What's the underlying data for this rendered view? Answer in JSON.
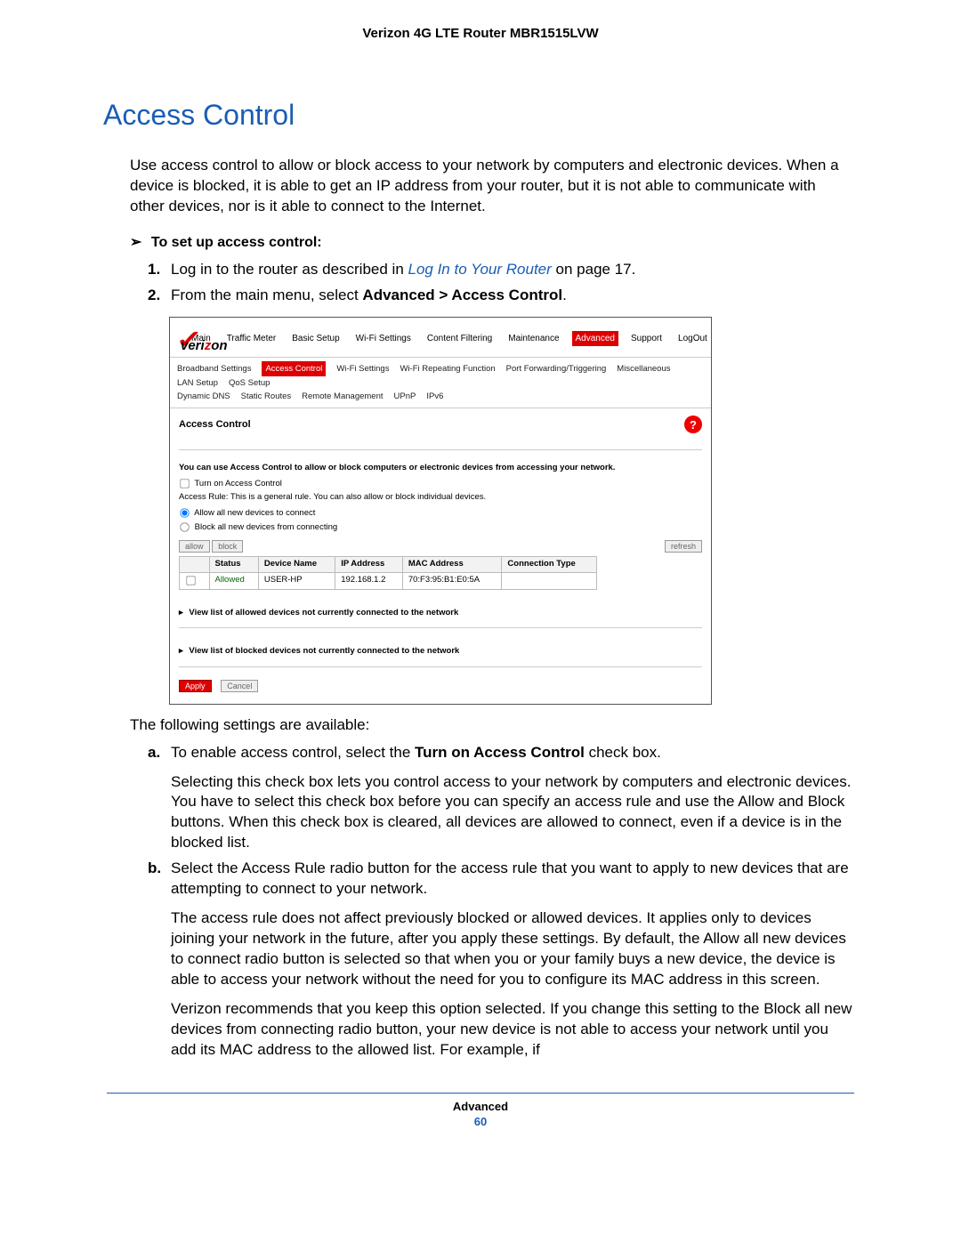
{
  "header": {
    "title": "Verizon 4G LTE Router MBR1515LVW"
  },
  "section": {
    "title": "Access Control"
  },
  "intro": "Use access control to allow or block access to your network by computers and electronic devices. When a device is blocked, it is able to get an IP address from your router, but it is not able to communicate with other devices, nor is it able to connect to the Internet.",
  "task_heading": "To set up access control:",
  "steps": {
    "s1_pre": "Log in to the router as described in ",
    "s1_link": "Log In to Your Router",
    "s1_post": " on page 17.",
    "s2_pre": "From the main menu, select ",
    "s2_bold": "Advanced > Access Control",
    "s2_post": "."
  },
  "router": {
    "logo_text_pre": "veri",
    "logo_text_hl": "z",
    "logo_text_post": "on",
    "mainnav": [
      "Main",
      "Traffic Meter",
      "Basic Setup",
      "Wi-Fi Settings",
      "Content Filtering",
      "Maintenance",
      "Advanced",
      "Support",
      "LogOut"
    ],
    "mainnav_active_index": 6,
    "subnav_row1": [
      "Broadband Settings",
      "Access Control",
      "Wi-Fi Settings",
      "Wi-Fi Repeating Function",
      "Port Forwarding/Triggering",
      "Miscellaneous",
      "LAN Setup",
      "QoS Setup"
    ],
    "subnav_row2": [
      "Dynamic DNS",
      "Static Routes",
      "Remote Management",
      "UPnP",
      "IPv6"
    ],
    "subnav_active_index": 1,
    "pane_title": "Access Control",
    "help": "?",
    "desc": "You can use Access Control to allow or block computers or electronic devices from accessing your network.",
    "chk_turn_on": "Turn on Access Control",
    "rule_line": "Access Rule: This is a general rule. You can also allow or block individual devices.",
    "radio_allow": "Allow all new devices to connect",
    "radio_block": "Block all new devices from connecting",
    "btn_allow": "allow",
    "btn_block": "block",
    "btn_refresh": "refresh",
    "table": {
      "headers": [
        "",
        "Status",
        "Device Name",
        "IP Address",
        "MAC Address",
        "Connection Type"
      ],
      "row": {
        "status": "Allowed",
        "device": "USER-HP",
        "ip": "192.168.1.2",
        "mac": "70:F3:95:B1:E0:5A",
        "conn": ""
      }
    },
    "exp_allowed": "View list of allowed devices not currently connected to the network",
    "exp_blocked": "View list of blocked devices not currently connected to the network",
    "btn_apply": "Apply",
    "btn_cancel": "Cancel"
  },
  "following_text": "The following settings are available:",
  "settings": {
    "a_first_pre": "To enable access control, select the ",
    "a_first_bold": "Turn on Access Control",
    "a_first_post": " check box.",
    "a_para": "Selecting this check box lets you control access to your network by computers and electronic devices. You have to select this check box before you can specify an access rule and use the Allow and Block buttons. When this check box is cleared, all devices are allowed to connect, even if a device is in the blocked list.",
    "b_first": "Select the Access Rule radio button for the access rule that you want to apply to new devices that are attempting to connect to your network.",
    "b_para1": "The access rule does not affect previously blocked or allowed devices. It applies only to devices joining your network in the future, after you apply these settings. By default, the Allow all new devices to connect radio button is selected so that when you or your family buys a new device, the device is able to access your network without the need for you to configure its MAC address in this screen.",
    "b_para2": "Verizon recommends that you keep this option selected. If you change this setting to the Block all new devices from connecting radio button, your new device is not able to access your network until you add its MAC address to the allowed list. For example, if"
  },
  "footer": {
    "section": "Advanced",
    "page": "60"
  }
}
